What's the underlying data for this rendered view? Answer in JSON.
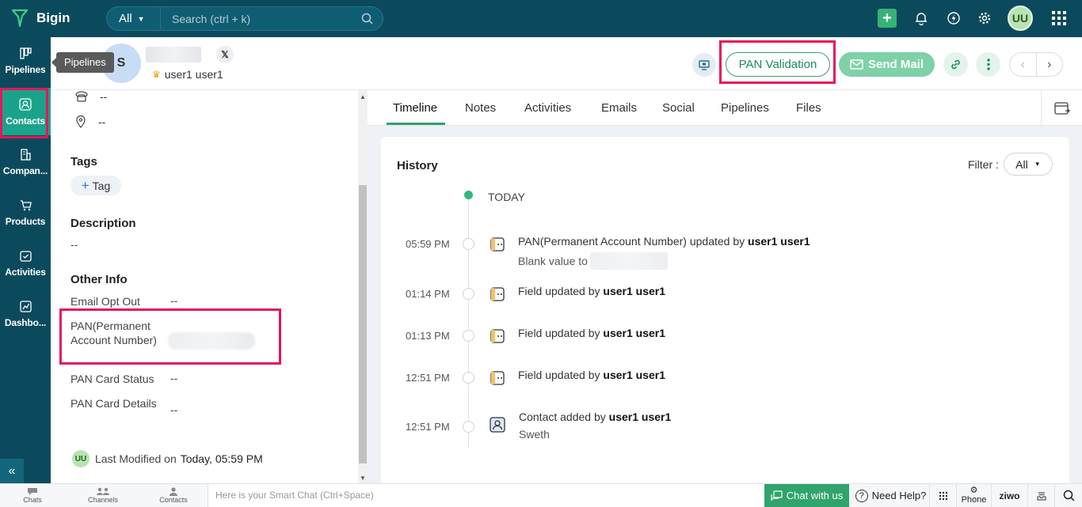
{
  "app": {
    "name": "Bigin"
  },
  "search": {
    "scope": "All",
    "placeholder": "Search (ctrl + k)"
  },
  "topbar": {
    "user_initials": "UU"
  },
  "sidebar": {
    "items": [
      {
        "label": "Pipelines",
        "icon": "pipelines-icon"
      },
      {
        "label": "Contacts",
        "icon": "contacts-icon"
      },
      {
        "label": "Compan...",
        "icon": "companies-icon"
      },
      {
        "label": "Products",
        "icon": "products-icon"
      },
      {
        "label": "Activities",
        "icon": "activities-icon"
      },
      {
        "label": "Dashbo...",
        "icon": "dashboards-icon"
      }
    ],
    "tooltip": "Pipelines",
    "collapse": "«"
  },
  "header": {
    "avatar_letter": "S",
    "x_badge": "𝕏",
    "owner": "user1 user1",
    "pan_button": "PAN Validation",
    "mail_button": "Send Mail"
  },
  "left": {
    "phone_value": "--",
    "address_value": "--",
    "tags_title": "Tags",
    "tag_button": "Tag",
    "description_title": "Description",
    "description_value": "--",
    "other_info_title": "Other Info",
    "fields": [
      {
        "label": "Email Opt Out",
        "value": "--"
      },
      {
        "label": "PAN(Permanent Account Number)",
        "value": ""
      },
      {
        "label": "PAN Card Status",
        "value": "--"
      },
      {
        "label": "PAN Card Details",
        "value": "--"
      }
    ],
    "last_modified_initials": "UU",
    "last_modified_label": "Last Modified on",
    "last_modified_value": "Today, 05:59 PM"
  },
  "tabs": [
    "Timeline",
    "Notes",
    "Activities",
    "Emails",
    "Social",
    "Pipelines",
    "Files"
  ],
  "history": {
    "title": "History",
    "filter_label": "Filter :",
    "filter_value": "All",
    "today": "TODAY",
    "entries": [
      {
        "time": "05:59 PM",
        "text": "PAN(Permanent Account Number) updated by ",
        "user": "user1 user1",
        "sub": "Blank value to"
      },
      {
        "time": "01:14 PM",
        "text": "Field updated by ",
        "user": "user1 user1"
      },
      {
        "time": "01:13 PM",
        "text": "Field updated by ",
        "user": "user1 user1"
      },
      {
        "time": "12:51 PM",
        "text": "Field updated by ",
        "user": "user1 user1"
      },
      {
        "time": "12:51 PM",
        "text": "Contact added by ",
        "user": "user1 user1",
        "sub": "Sweth"
      }
    ]
  },
  "bottombar": {
    "chats": "Chats",
    "channels": "Channels",
    "contacts": "Contacts",
    "smartchat_placeholder": "Here is your Smart Chat (Ctrl+Space)",
    "chat_with_us": "Chat with us",
    "need_help": "Need Help?",
    "phone": "Phone",
    "brand": "ziwo"
  }
}
